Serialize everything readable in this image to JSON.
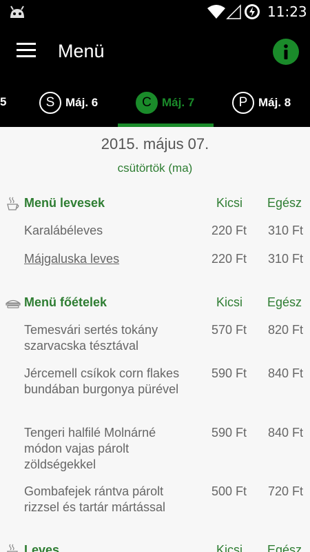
{
  "status_bar": {
    "time": "11:23",
    "icons": [
      "android-icon",
      "wifi-icon",
      "signal-icon",
      "battery-icon"
    ]
  },
  "toolbar": {
    "title": "Menü",
    "menu_icon": "hamburger-icon",
    "info_icon": "info-icon"
  },
  "tabs": {
    "partial_left": "5",
    "items": [
      {
        "letter": "S",
        "label": "Máj. 6",
        "active": false
      },
      {
        "letter": "C",
        "label": "Máj. 7",
        "active": true
      },
      {
        "letter": "P",
        "label": "Máj. 8",
        "active": false
      }
    ]
  },
  "content": {
    "date_title": "2015. május 07.",
    "day_label": "csütörtök (ma)",
    "sections": [
      {
        "name": "Menü levesek",
        "icon": "cup-icon",
        "col_small": "Kicsi",
        "col_full": "Egész",
        "items": [
          {
            "name": "Karalábéleves",
            "small": "220 Ft",
            "full": "310 Ft",
            "link": false
          },
          {
            "name": "Májgaluska leves",
            "small": "220 Ft",
            "full": "310 Ft",
            "link": true
          }
        ]
      },
      {
        "name": "Menü főételek",
        "icon": "plate-icon",
        "col_small": "Kicsi",
        "col_full": "Egész",
        "items": [
          {
            "name": "Temesvári sertés tokány szarvacska tésztával",
            "small": "570 Ft",
            "full": "820 Ft",
            "link": false
          },
          {
            "name": "Jércemell csíkok corn flakes bundában burgonya pürével",
            "small": "590 Ft",
            "full": "840 Ft",
            "link": false
          },
          {
            "name": "Tengeri halfilé Molnárné módon vajas párolt zöldségekkel",
            "small": "590 Ft",
            "full": "840 Ft",
            "link": false
          },
          {
            "name": "Gombafejek rántva párolt rizzsel és tartár mártással",
            "small": "500 Ft",
            "full": "720 Ft",
            "link": false
          }
        ]
      },
      {
        "name": "Leves",
        "icon": "cup-icon",
        "col_small": "Kicsi",
        "col_full": "Egész",
        "items": []
      }
    ]
  },
  "colors": {
    "accent": "#1a8b2a",
    "section_text": "#2e7d32",
    "bar_bg": "#000000",
    "content_bg": "#f7f7f7"
  }
}
